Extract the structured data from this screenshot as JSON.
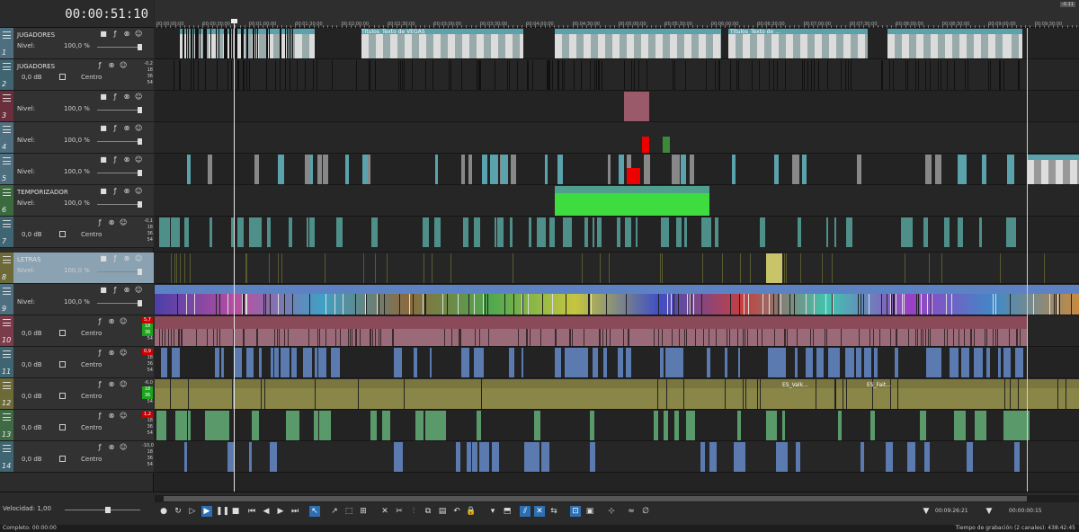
{
  "timecode": "00:00:51:10",
  "zoom_badge": "-0.11",
  "ruler_labels": [
    "00:00:00;00",
    "00:00:30;00",
    "00:01:00;00",
    "00:01:30;00",
    "00:02:00;00",
    "00:02:30;00",
    "00:03:00;00",
    "00:03:30;00",
    "00:04:00;00",
    "00:04:30;00",
    "00:05:00;00",
    "00:05:30;00",
    "00:06:00;00",
    "00:06:30;00",
    "00:07:00;00",
    "00:07:30;00",
    "00:08:00;00",
    "00:08:30;00",
    "00:09:00;00",
    "00:09:30;00"
  ],
  "tracks": [
    {
      "num": "1",
      "kind": "video",
      "name": "JUGADORES",
      "level_label": "Nivel:",
      "level_value": "100,0 %"
    },
    {
      "num": "2",
      "kind": "audio",
      "name": "JUGADORES",
      "db": "0,0 dB",
      "pan": "Centro",
      "meter": [
        "-0,2",
        "18",
        "36",
        "54"
      ]
    },
    {
      "num": "3",
      "kind": "video",
      "name": "",
      "level_label": "Nivel:",
      "level_value": "100,0 %"
    },
    {
      "num": "4",
      "kind": "video",
      "name": "",
      "level_label": "Nivel:",
      "level_value": "100,0 %"
    },
    {
      "num": "5",
      "kind": "video",
      "name": "",
      "level_label": "Nivel:",
      "level_value": "100,0 %"
    },
    {
      "num": "6",
      "kind": "video",
      "name": "TEMPORIZADOR",
      "level_label": "Nivel:",
      "level_value": "100,0 %"
    },
    {
      "num": "7",
      "kind": "audio",
      "name": "",
      "db": "0,0 dB",
      "pan": "Centro",
      "meter": [
        "-0,1",
        "18",
        "36",
        "54"
      ]
    },
    {
      "num": "8",
      "kind": "video",
      "name": "LETRAS",
      "level_label": "Nivel:",
      "level_value": "100,0 %"
    },
    {
      "num": "9",
      "kind": "video",
      "name": "",
      "level_label": "Nivel:",
      "level_value": "100,0 %"
    },
    {
      "num": "10",
      "kind": "audio",
      "name": "",
      "db": "0,0 dB",
      "pan": "Centro",
      "meter": [
        "5,7",
        "18",
        "36",
        "54"
      ]
    },
    {
      "num": "11",
      "kind": "audio",
      "name": "",
      "db": "0,0 dB",
      "pan": "Centro",
      "meter": [
        "0,9",
        "18",
        "36",
        "54"
      ]
    },
    {
      "num": "12",
      "kind": "audio",
      "name": "",
      "db": "0,0 dB",
      "pan": "Centro",
      "meter": [
        "-6,0",
        "18",
        "36",
        "54"
      ]
    },
    {
      "num": "13",
      "kind": "audio",
      "name": "",
      "db": "0,0 dB",
      "pan": "Centro",
      "meter": [
        "1,2",
        "18",
        "36",
        "54"
      ]
    },
    {
      "num": "14",
      "kind": "audio",
      "name": "",
      "db": "0,0 dB",
      "pan": "Centro",
      "meter": [
        "-10,0",
        "18",
        "36",
        "54"
      ]
    }
  ],
  "clip_labels": {
    "vegas_title_1": "Títulos_Texto de VEGAS",
    "vegas_title_2": "Títulos_Texto de ...",
    "es_valk": "ES_Valk...",
    "es_fait": "ES_Fait..."
  },
  "bottom": {
    "speed_label": "Velocidad: 1,00",
    "tc_cursor": "00:09:26:21",
    "tc_length": "00:00:00:15"
  },
  "status": {
    "left": "Completo: 00:00:00",
    "right": "Tiempo de grabación (2 canales): 438:42:45"
  },
  "colors": {
    "accent": "#2d6fb3",
    "video_clip": "#5aa2ac",
    "audio_clip_teal": "#4f8f8a",
    "audio_clip_rose": "#9a6a78",
    "audio_clip_olive": "#8a8648",
    "audio_clip_green": "#5a9a6a",
    "audio_clip_blue": "#5a7ab0",
    "timer_green": "#3fdc3f",
    "mosaic_blue": "#5d82c4"
  }
}
